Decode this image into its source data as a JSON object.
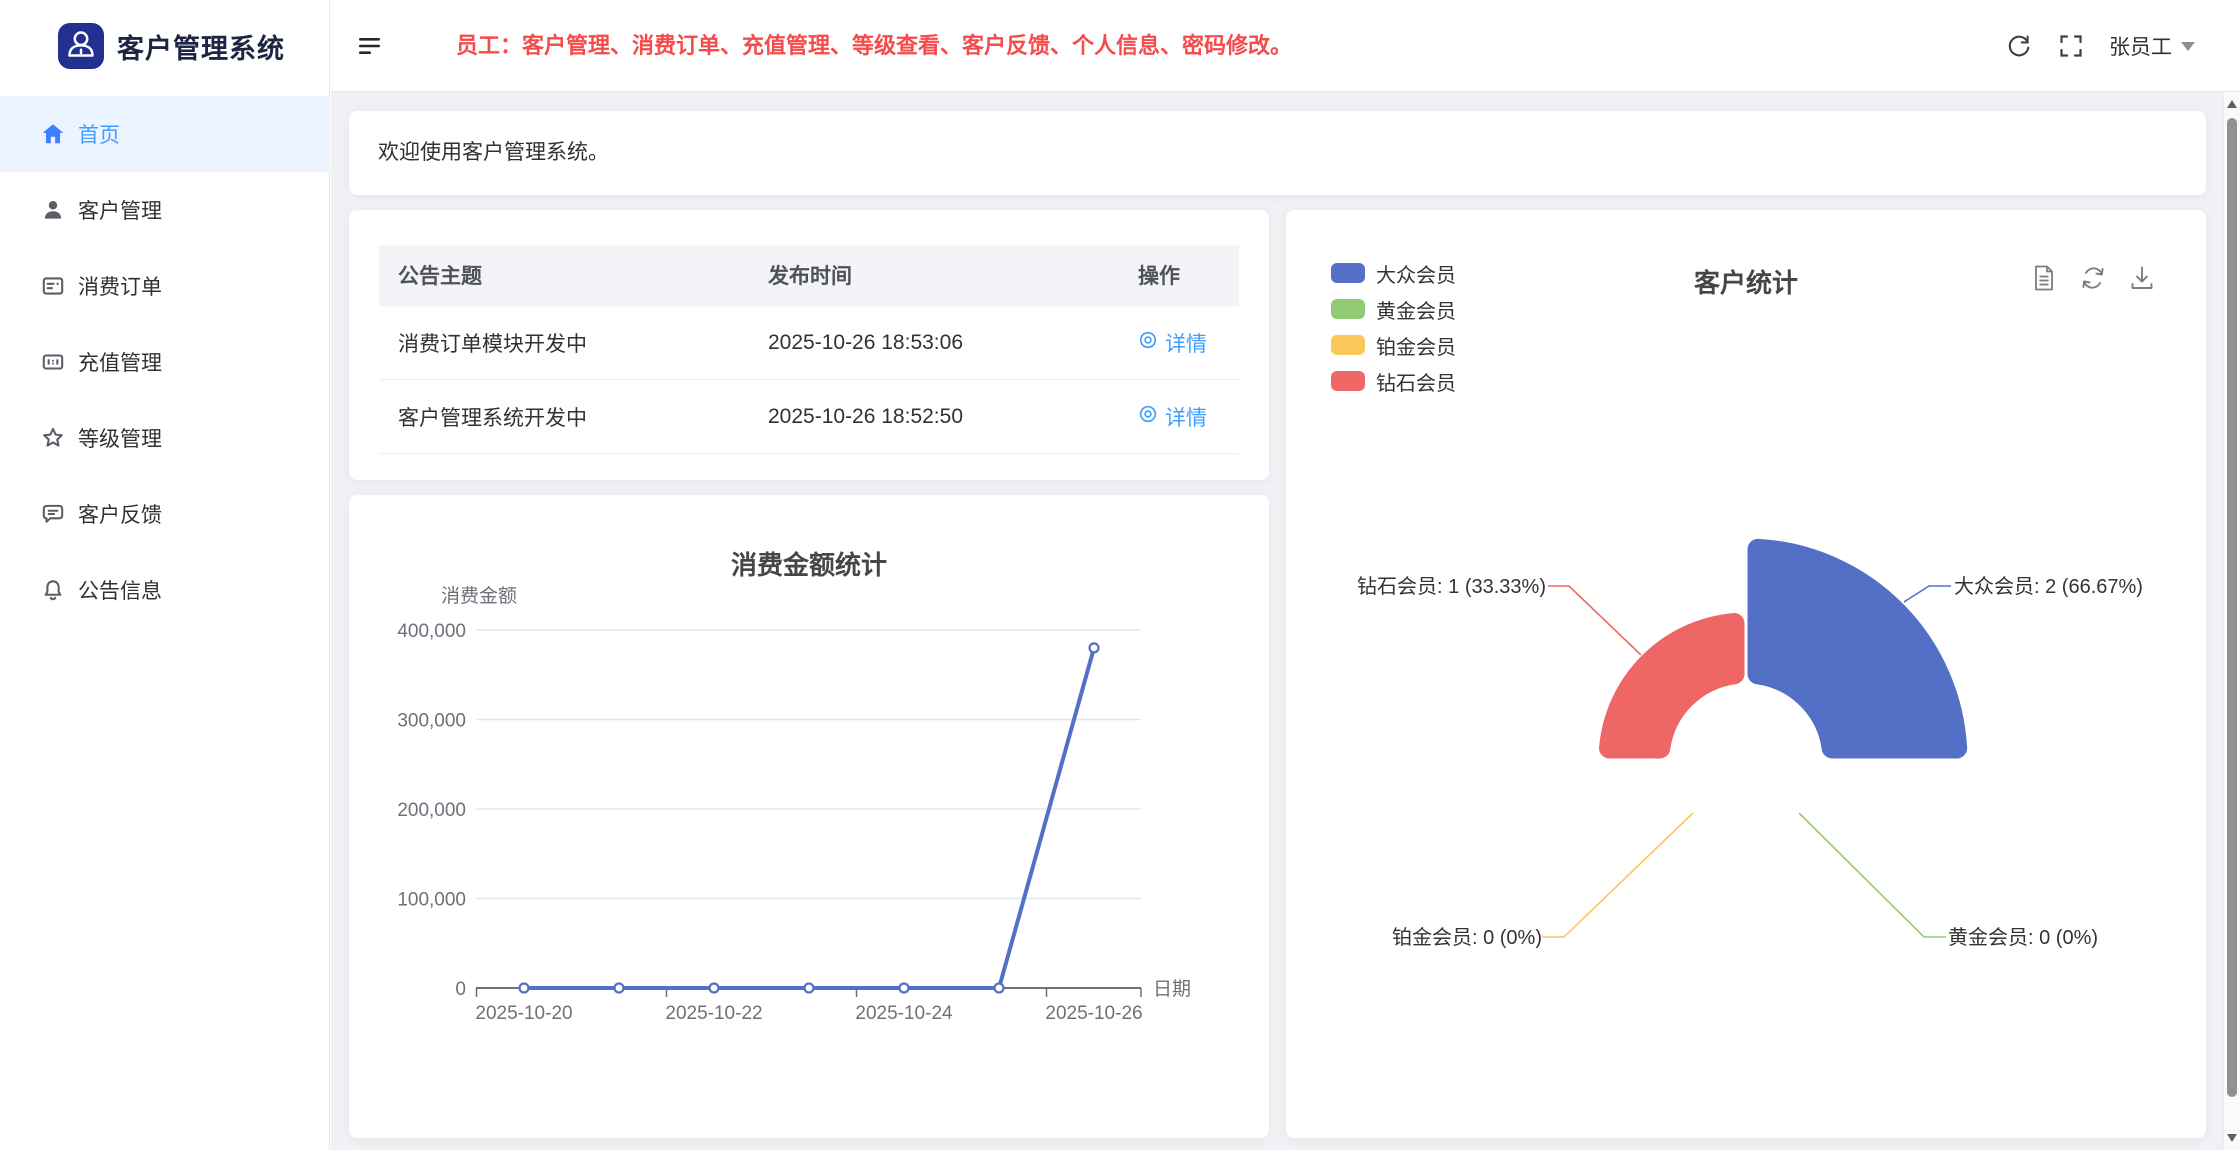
{
  "app": {
    "title": "客户管理系统"
  },
  "header": {
    "notice": "员工：客户管理、消费订单、充值管理、等级查看、客户反馈、个人信息、密码修改。",
    "user_name": "张员工",
    "icons": [
      "collapse-menu-icon",
      "refresh-icon",
      "fullscreen-icon",
      "user-dropdown-caret"
    ]
  },
  "sidebar": {
    "items": [
      {
        "label": "首页",
        "icon": "home-icon",
        "active": true
      },
      {
        "label": "客户管理",
        "icon": "user-icon",
        "active": false
      },
      {
        "label": "消费订单",
        "icon": "order-icon",
        "active": false
      },
      {
        "label": "充值管理",
        "icon": "recharge-card-icon",
        "active": false
      },
      {
        "label": "等级管理",
        "icon": "star-icon",
        "active": false
      },
      {
        "label": "客户反馈",
        "icon": "feedback-icon",
        "active": false
      },
      {
        "label": "公告信息",
        "icon": "bell-icon",
        "active": false
      }
    ]
  },
  "welcome": {
    "text": "欢迎使用客户管理系统。"
  },
  "announcements": {
    "columns": [
      "公告主题",
      "发布时间",
      "操作"
    ],
    "rows": [
      {
        "title": "消费订单模块开发中",
        "time": "2025-10-26 18:53:06",
        "action_label": "详情",
        "action_icon": "view-icon"
      },
      {
        "title": "客户管理系统开发中",
        "time": "2025-10-26 18:52:50",
        "action_label": "详情",
        "action_icon": "view-icon"
      }
    ]
  },
  "chart_data": [
    {
      "type": "line",
      "title": "消费金额统计",
      "xlabel": "日期",
      "ylabel": "消费金额",
      "x": [
        "2025-10-20",
        "2025-10-21",
        "2025-10-22",
        "2025-10-23",
        "2025-10-24",
        "2025-10-25",
        "2025-10-26"
      ],
      "values": [
        0,
        0,
        0,
        0,
        0,
        0,
        380000
      ],
      "x_tick_labels": [
        "2025-10-20",
        "2025-10-22",
        "2025-10-24",
        "2025-10-26"
      ],
      "y_ticks": [
        0,
        100000,
        200000,
        300000,
        400000
      ],
      "y_tick_labels": [
        "0",
        "100,000",
        "200,000",
        "300,000",
        "400,000"
      ],
      "ylim": [
        0,
        400000
      ],
      "grid": true,
      "line_color": "#5470c6",
      "marker": "hollow-circle"
    },
    {
      "type": "pie",
      "variant": "nightingale-rose-area",
      "title": "客户统计",
      "legend_position": "top-left",
      "toolbox_icons": [
        "data-view-icon",
        "restore-icon",
        "save-image-icon"
      ],
      "series": [
        {
          "name": "大众会员",
          "value": 2,
          "pct": "66.67%",
          "label": "大众会员: 2 (66.67%)",
          "color": "#5470c6"
        },
        {
          "name": "黄金会员",
          "value": 0,
          "pct": "0%",
          "label": "黄金会员: 0 (0%)",
          "color": "#91cc75"
        },
        {
          "name": "铂金会员",
          "value": 0,
          "pct": "0%",
          "label": "铂金会员: 0 (0%)",
          "color": "#fac858"
        },
        {
          "name": "钻石会员",
          "value": 1,
          "pct": "33.33%",
          "label": "钻石会员: 1 (33.33%)",
          "color": "#ee6666"
        }
      ],
      "total": 3
    }
  ],
  "theme": {
    "notice_color": "#f54b4b",
    "link_color": "#409eff",
    "sidebar_active_color": "#409eff",
    "sidebar_active_bg": "#ecf5ff",
    "logo_bg": "#22308f",
    "page_bg": "#f0f1f4",
    "palette": [
      "#5470c6",
      "#91cc75",
      "#fac858",
      "#ee6666"
    ]
  }
}
